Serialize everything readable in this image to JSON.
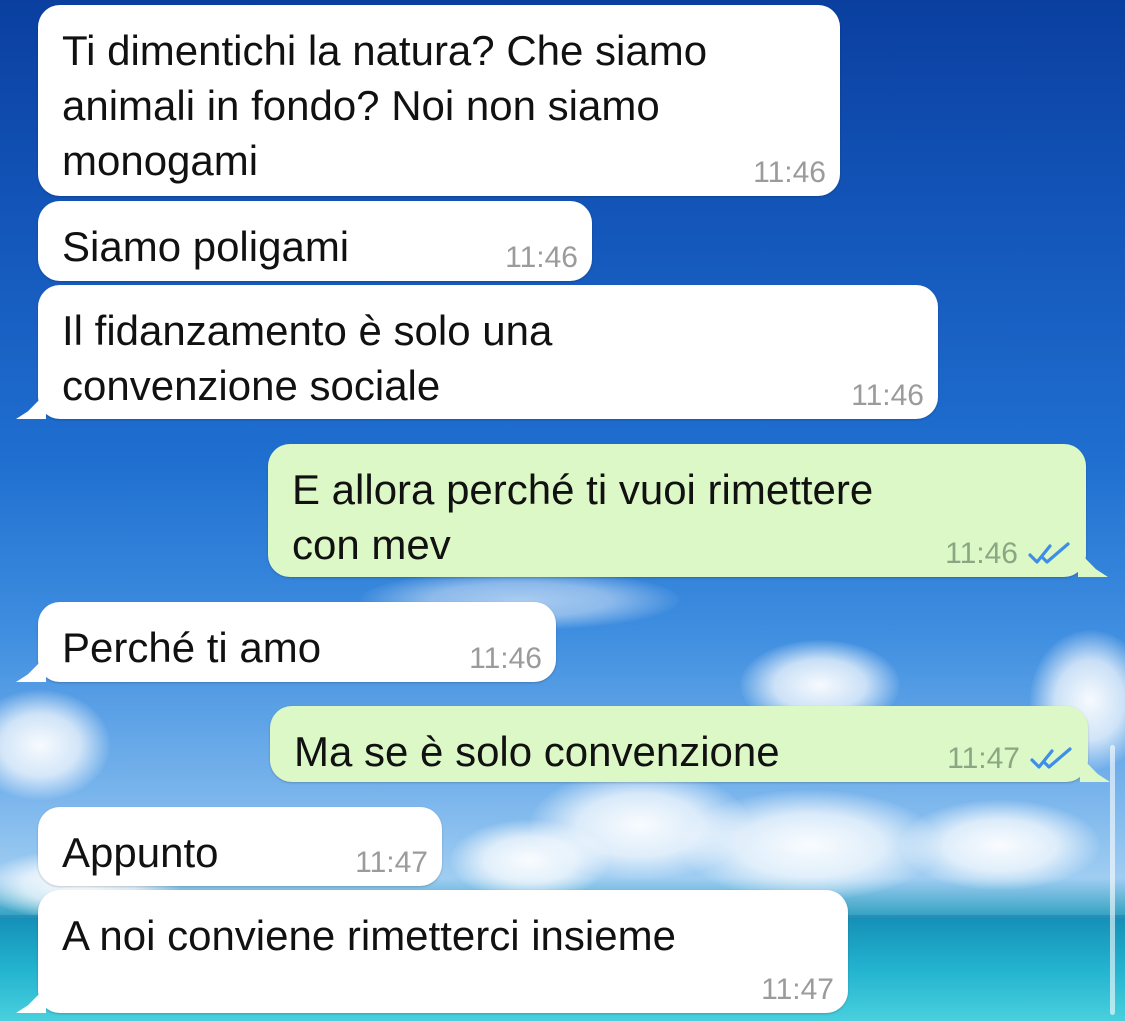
{
  "wallpaper": "sky-and-sea",
  "messages": [
    {
      "direction": "in",
      "text": "Ti dimentichi la natura? Che siamo\nanimali in fondo? Noi non siamo\nmonogami",
      "time": "11:46"
    },
    {
      "direction": "in",
      "text": "Siamo poligami",
      "time": "11:46"
    },
    {
      "direction": "in",
      "text": "Il fidanzamento è solo una\nconvenzione sociale",
      "time": "11:46"
    },
    {
      "direction": "out",
      "text": "E allora perché ti vuoi rimettere\ncon mev",
      "time": "11:46",
      "status": "read-double-check"
    },
    {
      "direction": "in",
      "text": "Perché ti amo",
      "time": "11:46"
    },
    {
      "direction": "out",
      "text": "Ma se è solo convenzione",
      "time": "11:47",
      "status": "read-double-check"
    },
    {
      "direction": "in",
      "text": "Appunto",
      "time": "11:47"
    },
    {
      "direction": "in",
      "text": "A noi conviene rimetterci insieme",
      "time": "11:47"
    }
  ],
  "colors": {
    "incoming_bubble": "#ffffff",
    "outgoing_bubble": "#dcf8c6",
    "timestamp": "#9b9b9b",
    "read_ticks": "#3e8ee8"
  },
  "icons": {
    "read_receipt": "double-check-icon"
  }
}
